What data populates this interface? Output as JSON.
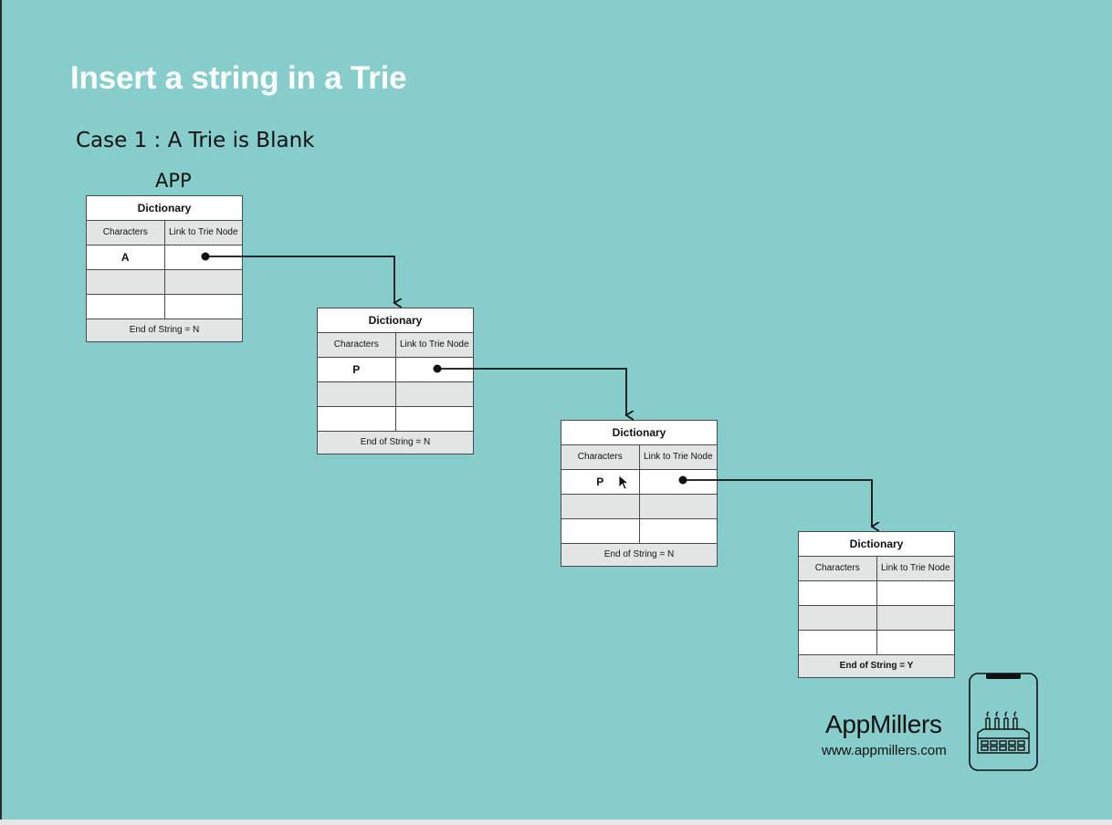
{
  "slide": {
    "title": "Insert a string in a Trie",
    "subtitle": "Case 1 : A Trie is Blank",
    "word": "APP"
  },
  "nodes": [
    {
      "title": "Dictionary",
      "col_char": "Characters",
      "col_link": "Link to Trie Node",
      "rows": [
        "A",
        "",
        ""
      ],
      "footer": "End of String = N"
    },
    {
      "title": "Dictionary",
      "col_char": "Characters",
      "col_link": "Link to Trie Node",
      "rows": [
        "P",
        "",
        ""
      ],
      "footer": "End of String = N"
    },
    {
      "title": "Dictionary",
      "col_char": "Characters",
      "col_link": "Link to Trie Node",
      "rows": [
        "P",
        "",
        ""
      ],
      "footer": "End of String = N"
    },
    {
      "title": "Dictionary",
      "col_char": "Characters",
      "col_link": "Link to Trie Node",
      "rows": [
        "",
        "",
        ""
      ],
      "footer": "End of String = Y"
    }
  ],
  "brand": {
    "name": "AppMillers",
    "url": "www.appmillers.com"
  },
  "colors": {
    "background": "#86cdcc",
    "title": "#ffffff",
    "row_gray": "#e3e4e4",
    "border": "#4a4a4a"
  },
  "icons": {
    "logo": "factory-phone-icon",
    "cursor": "mouse-pointer-icon"
  }
}
